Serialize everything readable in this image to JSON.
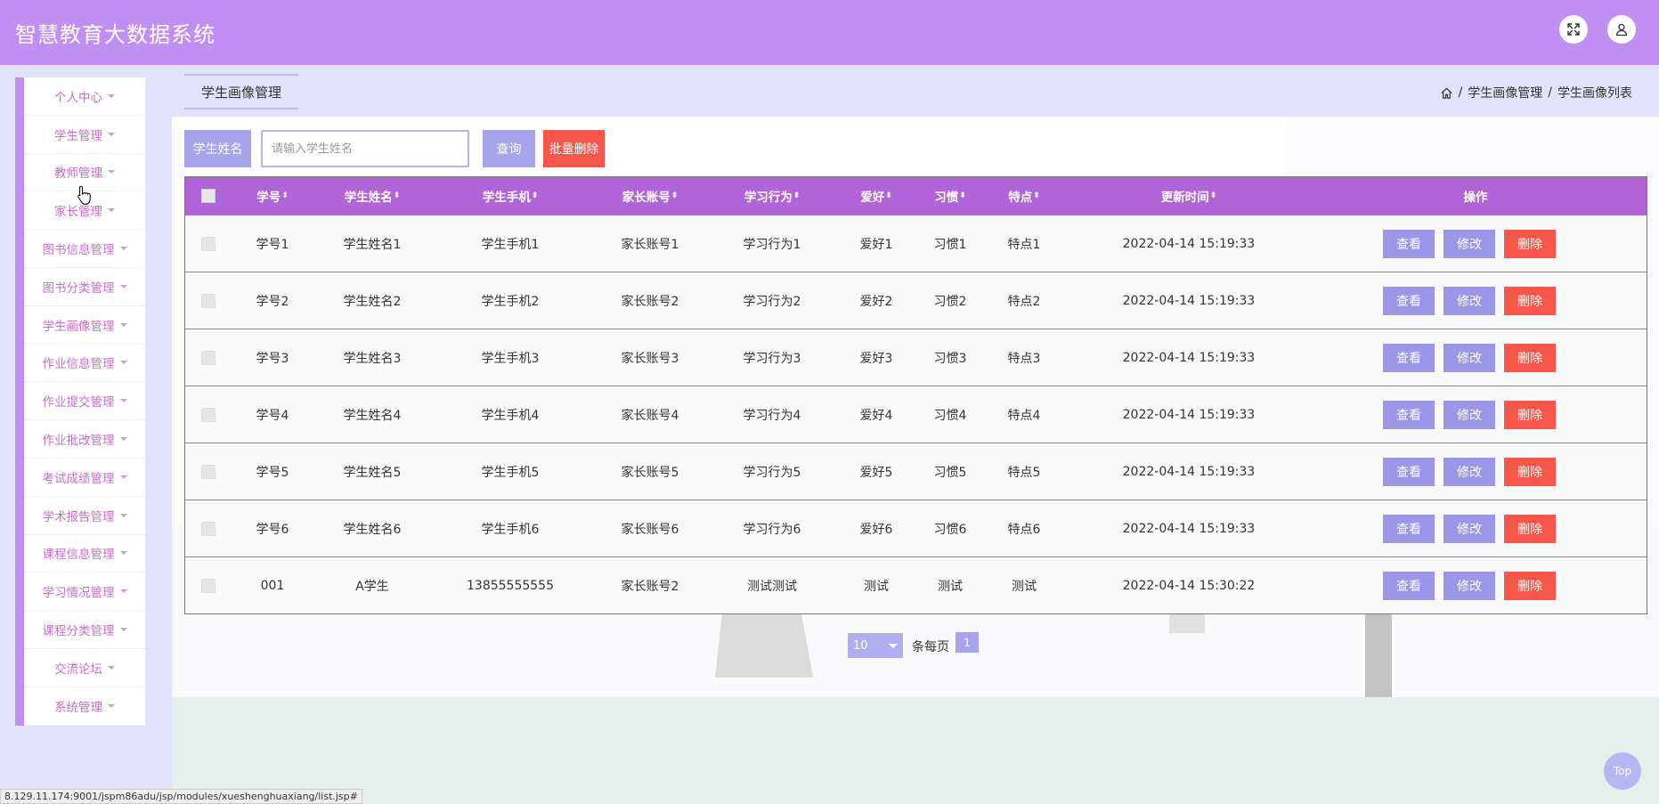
{
  "app": {
    "title": "智慧教育大数据系统"
  },
  "header": {
    "fullscreen_icon": "expand-icon",
    "user_icon": "user-icon"
  },
  "sidebar": {
    "items": [
      {
        "label": "个人中心"
      },
      {
        "label": "学生管理"
      },
      {
        "label": "教师管理"
      },
      {
        "label": "家长管理"
      },
      {
        "label": "图书信息管理"
      },
      {
        "label": "图书分类管理"
      },
      {
        "label": "学生画像管理"
      },
      {
        "label": "作业信息管理"
      },
      {
        "label": "作业提交管理"
      },
      {
        "label": "作业批改管理"
      },
      {
        "label": "考试成绩管理"
      },
      {
        "label": "学术报告管理"
      },
      {
        "label": "课程信息管理"
      },
      {
        "label": "学习情况管理"
      },
      {
        "label": "课程分类管理"
      },
      {
        "label": "交流论坛"
      },
      {
        "label": "系统管理"
      }
    ]
  },
  "page": {
    "tab": "学生画像管理",
    "breadcrumb": {
      "sep": "/",
      "level1": "学生画像管理",
      "level2": "学生画像列表"
    }
  },
  "search": {
    "label": "学生姓名",
    "placeholder": "请输入学生姓名",
    "value": "",
    "query_label": "查询",
    "batch_delete_label": "批量删除"
  },
  "table": {
    "headers": {
      "xuehao": "学号",
      "xingming": "学生姓名",
      "shouji": "学生手机",
      "jiazhang": "家长账号",
      "xingwei": "学习行为",
      "aihao": "爱好",
      "xiguan": "习惯",
      "tedian": "特点",
      "time": "更新时间",
      "ops": "操作"
    },
    "sort_glyph": "⬍",
    "actions": {
      "view": "查看",
      "edit": "修改",
      "delete": "删除"
    },
    "rows": [
      {
        "xuehao": "学号1",
        "xingming": "学生姓名1",
        "shouji": "学生手机1",
        "jiazhang": "家长账号1",
        "xingwei": "学习行为1",
        "aihao": "爱好1",
        "xiguan": "习惯1",
        "tedian": "特点1",
        "time": "2022-04-14 15:19:33"
      },
      {
        "xuehao": "学号2",
        "xingming": "学生姓名2",
        "shouji": "学生手机2",
        "jiazhang": "家长账号2",
        "xingwei": "学习行为2",
        "aihao": "爱好2",
        "xiguan": "习惯2",
        "tedian": "特点2",
        "time": "2022-04-14 15:19:33"
      },
      {
        "xuehao": "学号3",
        "xingming": "学生姓名3",
        "shouji": "学生手机3",
        "jiazhang": "家长账号3",
        "xingwei": "学习行为3",
        "aihao": "爱好3",
        "xiguan": "习惯3",
        "tedian": "特点3",
        "time": "2022-04-14 15:19:33"
      },
      {
        "xuehao": "学号4",
        "xingming": "学生姓名4",
        "shouji": "学生手机4",
        "jiazhang": "家长账号4",
        "xingwei": "学习行为4",
        "aihao": "爱好4",
        "xiguan": "习惯4",
        "tedian": "特点4",
        "time": "2022-04-14 15:19:33"
      },
      {
        "xuehao": "学号5",
        "xingming": "学生姓名5",
        "shouji": "学生手机5",
        "jiazhang": "家长账号5",
        "xingwei": "学习行为5",
        "aihao": "爱好5",
        "xiguan": "习惯5",
        "tedian": "特点5",
        "time": "2022-04-14 15:19:33"
      },
      {
        "xuehao": "学号6",
        "xingming": "学生姓名6",
        "shouji": "学生手机6",
        "jiazhang": "家长账号6",
        "xingwei": "学习行为6",
        "aihao": "爱好6",
        "xiguan": "习惯6",
        "tedian": "特点6",
        "time": "2022-04-14 15:19:33"
      },
      {
        "xuehao": "001",
        "xingming": "A学生",
        "shouji": "13855555555",
        "jiazhang": "家长账号2",
        "xingwei": "测试测试",
        "aihao": "测试",
        "xiguan": "测试",
        "tedian": "测试",
        "time": "2022-04-14 15:30:22"
      }
    ]
  },
  "pagination": {
    "page_size": "10",
    "per_page_label": "条每页",
    "current_page": "1"
  },
  "top_button": "Top",
  "status_bar": {
    "url": "8.129.11.174:9001/jspm86adu/jsp/modules/xueshenghuaxiang/list.jsp#"
  },
  "colors": {
    "header": "#c18ff2",
    "sidebar_text": "#c96ccd",
    "table_header": "#b064d8",
    "primary_button": "#a7a4ee",
    "danger_button": "#f7574a",
    "content_bg": "#e2e2fb"
  }
}
